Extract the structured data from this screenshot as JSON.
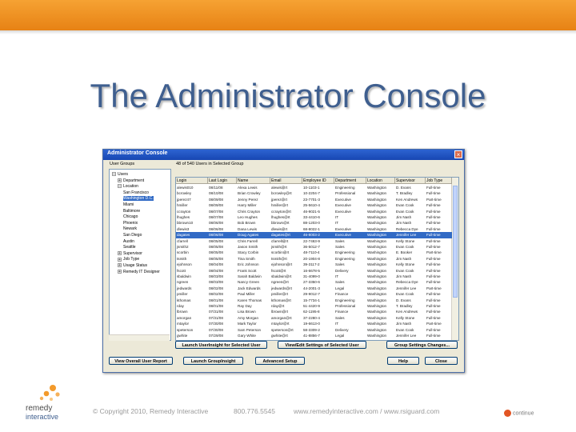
{
  "slide": {
    "title": "The Administrator Console"
  },
  "window": {
    "title": "Administrator Console",
    "close_glyph": "×",
    "left_pane_header": "User Groups",
    "right_pane_header": "48 of 540 Users in Selected Group",
    "tree": [
      {
        "label": "Users",
        "expander": "–"
      },
      {
        "label": "Department",
        "expander": "+"
      },
      {
        "label": "Location",
        "expander": "–"
      },
      {
        "label": "San Francisco",
        "expander": ""
      },
      {
        "label": "Washington D.C.",
        "expander": "",
        "selected": true
      },
      {
        "label": "Miami",
        "expander": ""
      },
      {
        "label": "Baltimore",
        "expander": ""
      },
      {
        "label": "Chicago",
        "expander": ""
      },
      {
        "label": "Phoenix",
        "expander": ""
      },
      {
        "label": "Newark",
        "expander": ""
      },
      {
        "label": "San Diego",
        "expander": ""
      },
      {
        "label": "Austin",
        "expander": ""
      },
      {
        "label": "Seattle",
        "expander": ""
      },
      {
        "label": "Supervisor",
        "expander": "+"
      },
      {
        "label": "Job Type",
        "expander": "+"
      },
      {
        "label": "Usage Status",
        "expander": "+"
      },
      {
        "label": "Remedy IT Designer",
        "expander": "+"
      }
    ],
    "columns": [
      "Login",
      "Last Login",
      "Name",
      "Email",
      "Employee ID",
      "Department",
      "Location",
      "Supervisor",
      "Job Type"
    ],
    "rows": [
      [
        "alewis010",
        "08/11/08",
        "Alexa Lewis",
        "alewis@rt",
        "10-1103-1",
        "Engineering",
        "Washington",
        "D. Evans",
        "Full-time"
      ],
      [
        "bcrowley",
        "08/10/08",
        "Brian Crowley",
        "bcrowley@rt",
        "10-2204-7",
        "Professional",
        "Washington",
        "T. Bradley",
        "Full-time"
      ],
      [
        "jperez47",
        "08/09/08",
        "Jenny Perez",
        "jperez@rt",
        "23-7701-3",
        "Executive",
        "Washington",
        "Ken Andrews",
        "Part-time"
      ],
      [
        "hmiller",
        "08/09/08",
        "Harry Miller",
        "hmiller@rt",
        "25-5610-4",
        "Executive",
        "Washington",
        "Evan Cook",
        "Full-time"
      ],
      [
        "ccrayton",
        "08/07/08",
        "Chris Crayton",
        "ccrayton@rt",
        "46-9021-5",
        "Executive",
        "Washington",
        "Evan Cook",
        "Full-time"
      ],
      [
        "lhughes",
        "08/07/08",
        "Leo Hughes",
        "lhughes@rt",
        "33-4410-6",
        "IT",
        "Washington",
        "Jim Nash",
        "Full-time"
      ],
      [
        "bbrown10",
        "08/06/08",
        "Bob Brown",
        "bbrown@rt",
        "88-1203-0",
        "IT",
        "Washington",
        "Jim Nash",
        "Full-time"
      ],
      [
        "dlewis3",
        "08/06/08",
        "Dana Lewis",
        "dlewis@rt",
        "68-8022-1",
        "Executive",
        "Washington",
        "Rebecca Dye",
        "Full-time"
      ],
      [
        "dagates",
        "08/06/08",
        "Doug Agates",
        "dagates@rt",
        "46-8003-2",
        "Executive",
        "Washington",
        "Jennifer Lee",
        "Full-time"
      ],
      [
        "cfarrell",
        "08/05/08",
        "Chris Farrell",
        "cfarrell@rt",
        "22-7463-9",
        "Sales",
        "Washington",
        "Kelly Stone",
        "Full-time"
      ],
      [
        "jsmith2",
        "08/05/08",
        "Jason Smith",
        "jsmith@rt",
        "36-5012-7",
        "Sales",
        "Washington",
        "Evan Cook",
        "Full-time"
      ],
      [
        "scorbin",
        "08/05/08",
        "Stacy Corbin",
        "scorbin@rt",
        "48-7110-4",
        "Engineering",
        "Washington",
        "E. Booker",
        "Part-time"
      ],
      [
        "tsmith",
        "08/05/08",
        "Tina Smith",
        "tsmith@rt",
        "20-1904-8",
        "Engineering",
        "Washington",
        "Jim Nash",
        "Full-time"
      ],
      [
        "ejohnson",
        "08/04/08",
        "Eric Johnson",
        "ejohnson@rt",
        "39-3117-2",
        "Sales",
        "Washington",
        "Kelly Stone",
        "Full-time"
      ],
      [
        "fscott",
        "08/04/08",
        "Frank Scott",
        "fscott@rt",
        "16-6678-5",
        "Delivery",
        "Washington",
        "Evan Cook",
        "Full-time"
      ],
      [
        "sbaldwin",
        "08/03/08",
        "Sarah Baldwin",
        "sbaldwin@rt",
        "31-4099-0",
        "IT",
        "Washington",
        "Jim Nash",
        "Full-time"
      ],
      [
        "ngreen",
        "08/03/08",
        "Nancy Green",
        "ngreen@rt",
        "27-3350-6",
        "Sales",
        "Washington",
        "Rebecca Dye",
        "Full-time"
      ],
      [
        "jedwards",
        "08/02/08",
        "Jack Edwards",
        "jedwards@rt",
        "44-2001-3",
        "Legal",
        "Washington",
        "Jennifer Lee",
        "Part-time"
      ],
      [
        "pmiller",
        "08/02/08",
        "Paul Miller",
        "pmiller@rt",
        "29-9012-7",
        "Finance",
        "Washington",
        "Evan Cook",
        "Full-time"
      ],
      [
        "kthomas",
        "08/01/08",
        "Karen Thomas",
        "kthomas@rt",
        "15-7734-1",
        "Engineering",
        "Washington",
        "D. Evans",
        "Full-time"
      ],
      [
        "rday",
        "08/01/08",
        "Ray Day",
        "rday@rt",
        "51-4420-9",
        "Professional",
        "Washington",
        "T. Bradley",
        "Full-time"
      ],
      [
        "lbrown",
        "07/31/08",
        "Lisa Brown",
        "lbrown@rt",
        "62-1195-8",
        "Finance",
        "Washington",
        "Ken Andrews",
        "Full-time"
      ],
      [
        "amorgan",
        "07/31/08",
        "Amy Morgan",
        "amorgan@rt",
        "37-2280-4",
        "Sales",
        "Washington",
        "Kelly Stone",
        "Full-time"
      ],
      [
        "mtaylor",
        "07/30/08",
        "Mark Taylor",
        "mtaylor@rt",
        "19-6613-0",
        "IT",
        "Washington",
        "Jim Nash",
        "Part-time"
      ],
      [
        "speterson",
        "07/30/08",
        "Sam Peterson",
        "speterson@rt",
        "58-3309-2",
        "Delivery",
        "Washington",
        "Evan Cook",
        "Full-time"
      ],
      [
        "gwhite",
        "07/29/08",
        "Gary White",
        "gwhite@rt",
        "41-8856-7",
        "Legal",
        "Washington",
        "Jennifer Lee",
        "Full-time"
      ]
    ],
    "selected_row": 8,
    "buttons": {
      "launch_usersight": "Launch UserInsight for Selected User",
      "view_edit_settings": "View/Edit Settings of Selected User",
      "group_settings": "Group Settings Changes...",
      "view_overall": "View Overall User Report",
      "launch_groupinsight": "Launch GroupInsight",
      "advanced_setup": "Advanced Setup",
      "help": "Help",
      "close": "Close"
    }
  },
  "footer": {
    "logo_line1": "remedy",
    "logo_line2": "interactive",
    "copyright": "© Copyright 2010, Remedy Interactive",
    "phone": "800.776.5545",
    "websites": "www.remedyinteractive.com / www.rsiguard.com",
    "continue": "continue"
  },
  "colors": {
    "accent": "#f39a2b",
    "title": "#3f5f8f",
    "window_border": "#4e6fa8",
    "selection": "#316ac5"
  }
}
